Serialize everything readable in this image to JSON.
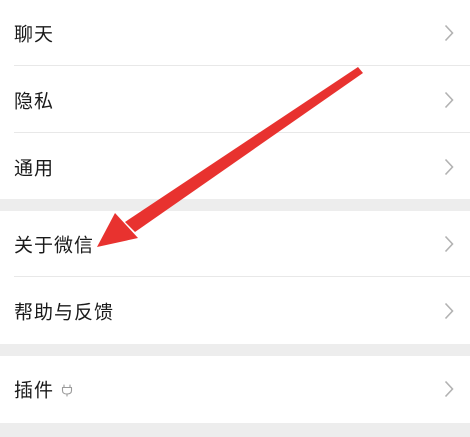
{
  "settings": {
    "items": [
      {
        "label": "聊天"
      },
      {
        "label": "隐私"
      },
      {
        "label": "通用"
      },
      {
        "label": "关于微信"
      },
      {
        "label": "帮助与反馈"
      },
      {
        "label": "插件",
        "icon": "plugin-icon"
      }
    ],
    "chevron_icon": "chevron-right-icon"
  },
  "annotation": {
    "arrow_icon": "red-arrow-icon",
    "arrow_color": "#e8322f"
  },
  "colors": {
    "page_background": "#ededed",
    "row_background": "#ffffff",
    "divider": "#e8e8e8",
    "text": "#1a1a1a",
    "chevron": "#b2b2b2"
  }
}
